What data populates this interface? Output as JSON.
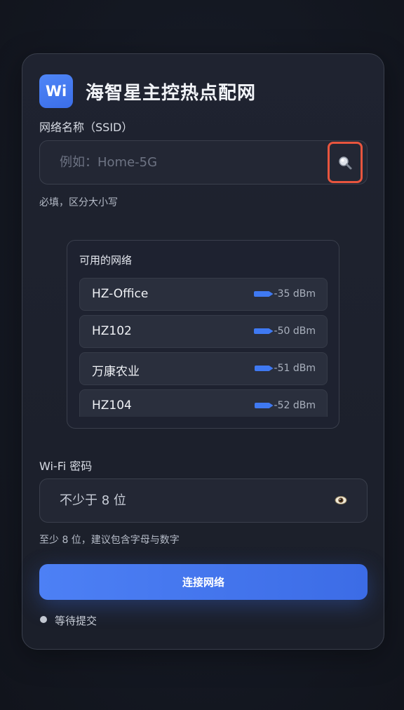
{
  "app": {
    "icon_text": "Wi",
    "title": "海智星主控热点配网"
  },
  "ssid": {
    "label": "网络名称（SSID）",
    "placeholder": "例如：Home-5G",
    "value": "",
    "hint": "必填，区分大小写",
    "search_icon": "magnifier-icon"
  },
  "networks": {
    "title": "可用的网络",
    "items": [
      {
        "name": "HZ-Office",
        "signal": "-35 dBm"
      },
      {
        "name": "HZ102",
        "signal": "-50 dBm"
      },
      {
        "name": "万康农业",
        "signal": "-51 dBm"
      },
      {
        "name": "HZ104",
        "signal": "-52 dBm"
      }
    ],
    "signal_icon": "signal-bar-icon"
  },
  "password": {
    "label": "Wi-Fi 密码",
    "placeholder": "不少于 8 位",
    "value": "",
    "hint": "至少 8 位，建议包含字母与数字",
    "toggle_icon": "eye-icon"
  },
  "actions": {
    "connect_label": "连接网络"
  },
  "status": {
    "text": "等待提交"
  },
  "colors": {
    "accent": "#3f79f2",
    "highlight_border": "#e8553e",
    "background": "#131722",
    "card": "#1f2330"
  }
}
